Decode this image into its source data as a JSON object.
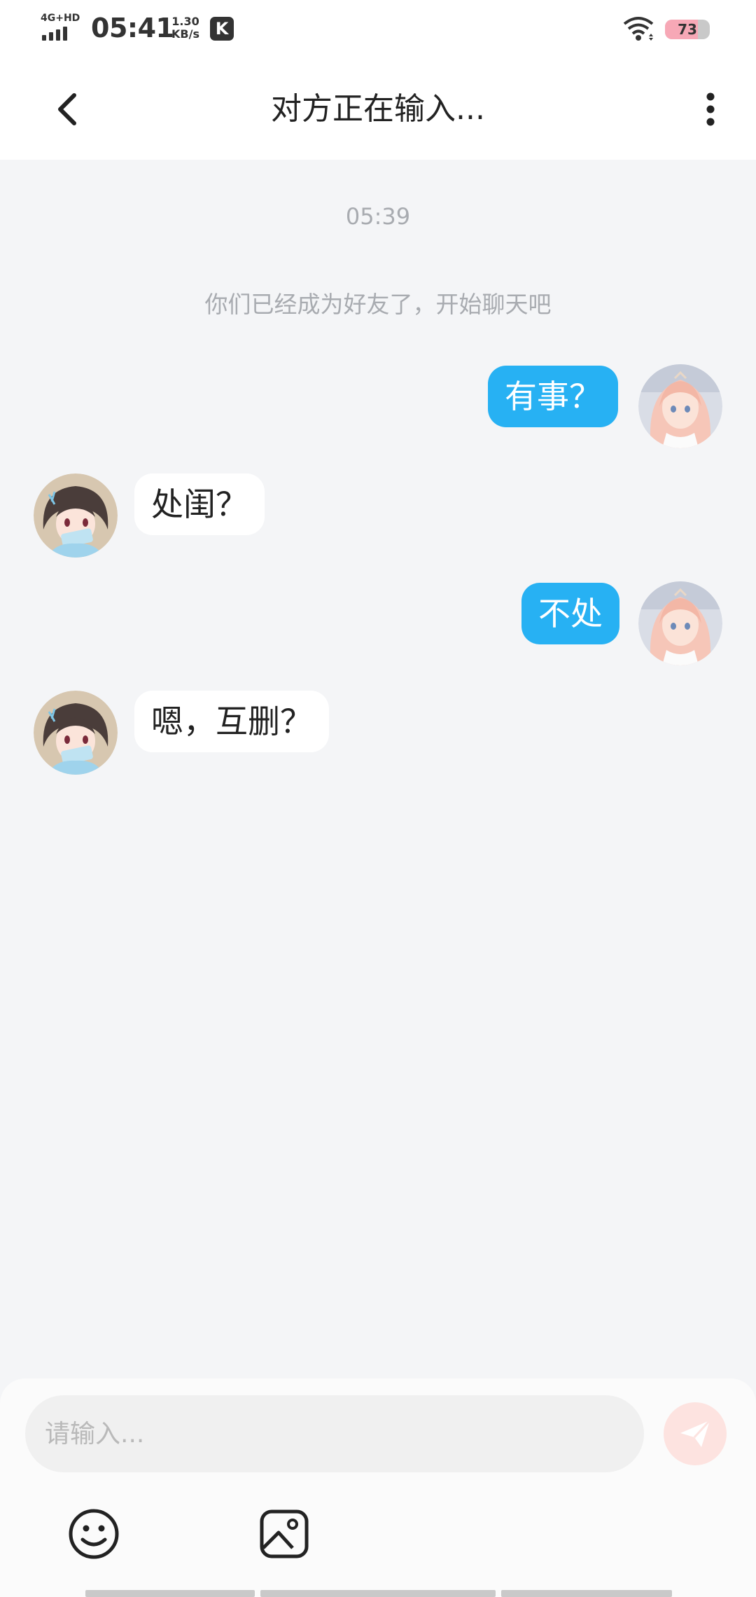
{
  "status_bar": {
    "network": "4G+HD",
    "time": "05:41",
    "speed_value": "1.30",
    "speed_unit": "KB/s",
    "app_badge": "K",
    "battery_level": "73",
    "battery_fraction": 0.73
  },
  "header": {
    "title": "对方正在输入...",
    "back_icon": "chevron-left-icon",
    "more_icon": "more-vertical-icon"
  },
  "chat": {
    "time_label": "05:39",
    "system_message": "你们已经成为好友了，开始聊天吧",
    "messages": [
      {
        "side": "out",
        "text": "有事？"
      },
      {
        "side": "in",
        "text": "处闺？"
      },
      {
        "side": "out",
        "text": "不处"
      },
      {
        "side": "in",
        "text": "嗯，互删？"
      }
    ]
  },
  "composer": {
    "placeholder": "请输入...",
    "send_icon": "paper-plane-icon",
    "emoji_icon": "smiley-icon",
    "image_icon": "image-icon"
  },
  "colors": {
    "outgoing_bubble": "#27b1f3",
    "incoming_bubble": "#ffffff",
    "chat_background": "#f4f5f7",
    "send_button": "#fde3e0"
  }
}
